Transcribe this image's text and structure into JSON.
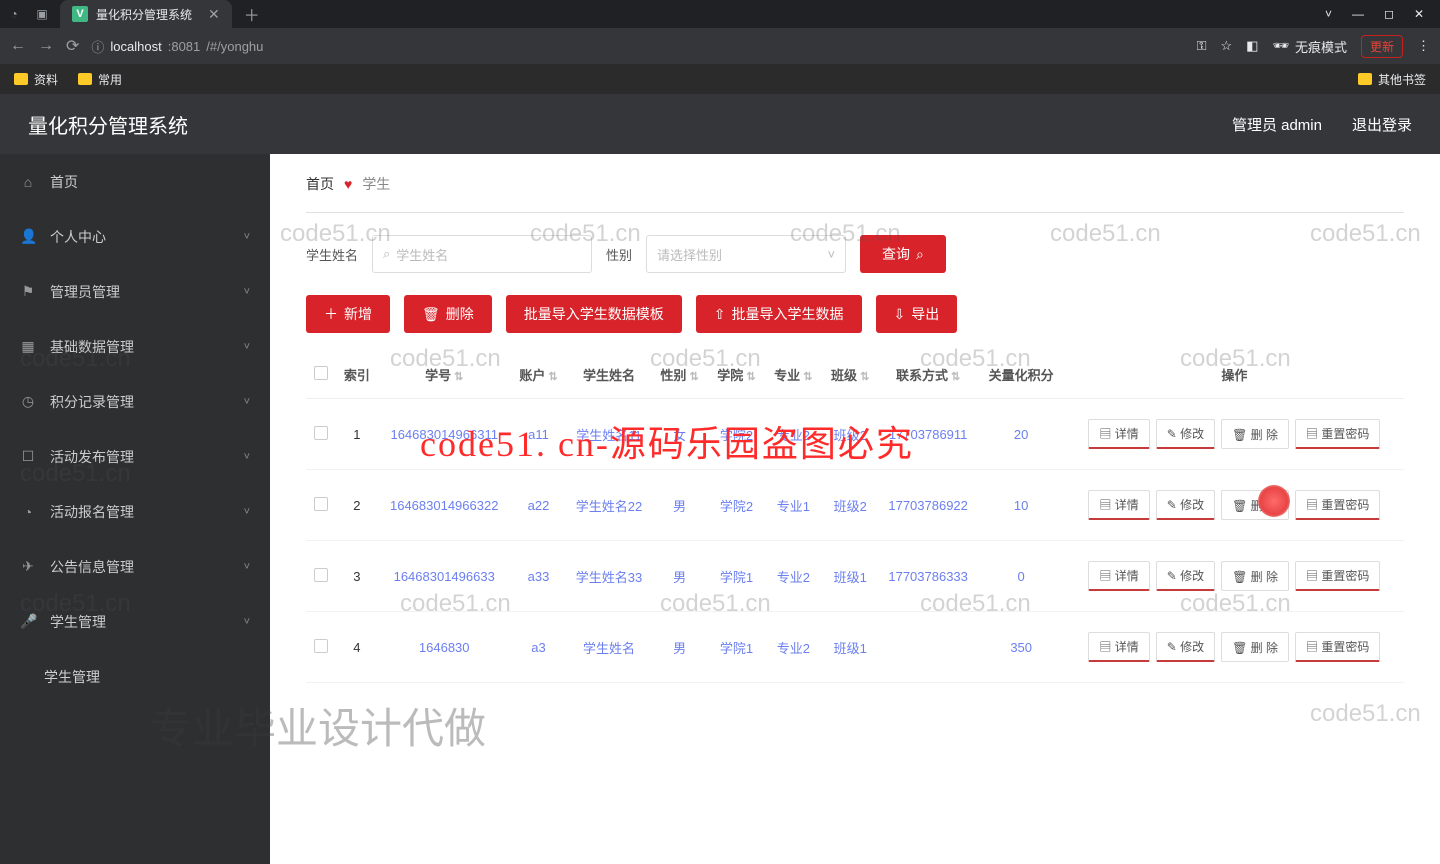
{
  "browser": {
    "tab_title": "量化积分管理系统",
    "url_prefix": "localhost",
    "url_port": ":8081",
    "url_path": "/#/yonghu",
    "incognito": "无痕模式",
    "update": "更新",
    "bookmarks": {
      "b1": "资料",
      "b2": "常用",
      "other": "其他书签"
    }
  },
  "header": {
    "title": "量化积分管理系统",
    "user": "管理员 admin",
    "logout": "退出登录"
  },
  "sidebar": [
    {
      "icon": "⌂",
      "label": "首页",
      "arrow": false
    },
    {
      "icon": "👤",
      "label": "个人中心",
      "arrow": true
    },
    {
      "icon": "⚑",
      "label": "管理员管理",
      "arrow": true
    },
    {
      "icon": "▦",
      "label": "基础数据管理",
      "arrow": true
    },
    {
      "icon": "◷",
      "label": "积分记录管理",
      "arrow": true
    },
    {
      "icon": "☐",
      "label": "活动发布管理",
      "arrow": true
    },
    {
      "icon": "◔",
      "label": "活动报名管理",
      "arrow": true
    },
    {
      "icon": "✈",
      "label": "公告信息管理",
      "arrow": true
    },
    {
      "icon": "🎤",
      "label": "学生管理",
      "arrow": true
    },
    {
      "icon": "",
      "label": "学生管理",
      "arrow": false,
      "sub": true
    }
  ],
  "breadcrumb": {
    "home": "首页",
    "current": "学生"
  },
  "search": {
    "name_label": "学生姓名",
    "name_ph": "学生姓名",
    "gender_label": "性别",
    "gender_ph": "请选择性别",
    "query_btn": "查询"
  },
  "actions": {
    "add": "新增",
    "delete": "删除",
    "tpl": "批量导入学生数据模板",
    "import": "批量导入学生数据",
    "export": "导出"
  },
  "columns": {
    "idx": "索引",
    "sno": "学号",
    "acc": "账户",
    "name": "学生姓名",
    "gender": "性别",
    "college": "学院",
    "major": "专业",
    "cls": "班级",
    "phone": "联系方式",
    "score": "关量化积分",
    "ops": "操作"
  },
  "ops": {
    "detail": "详情",
    "edit": "修改",
    "del": "删 除",
    "reset": "重置密码"
  },
  "rows": [
    {
      "idx": "1",
      "sno": "164683014966311",
      "acc": "a11",
      "name": "学生姓名11",
      "gender": "女",
      "college": "学院2",
      "major": "专业2",
      "cls": "班级2",
      "phone": "177037869​11",
      "score": "20"
    },
    {
      "idx": "2",
      "sno": "164683014966322",
      "acc": "a22",
      "name": "学生姓名22",
      "gender": "男",
      "college": "学院2",
      "major": "专业1",
      "cls": "班级2",
      "phone": "177037869​22",
      "score": "10"
    },
    {
      "idx": "3",
      "sno": "1646830149​6633",
      "acc": "a33",
      "name": "学生姓名33",
      "gender": "男",
      "college": "学院1",
      "major": "专业2",
      "cls": "班级1",
      "phone": "177037863​33",
      "score": "0"
    },
    {
      "idx": "4",
      "sno": "1646830",
      "acc": "a3",
      "name": "学生姓名",
      "gender": "男",
      "college": "学院1",
      "major": "专业2",
      "cls": "班级1",
      "phone": "",
      "score": "350"
    }
  ],
  "watermark_text": "code51.cn",
  "wm_red": "code51. cn-源码乐园盗图必究",
  "wm_service": "专业毕业设计代做"
}
